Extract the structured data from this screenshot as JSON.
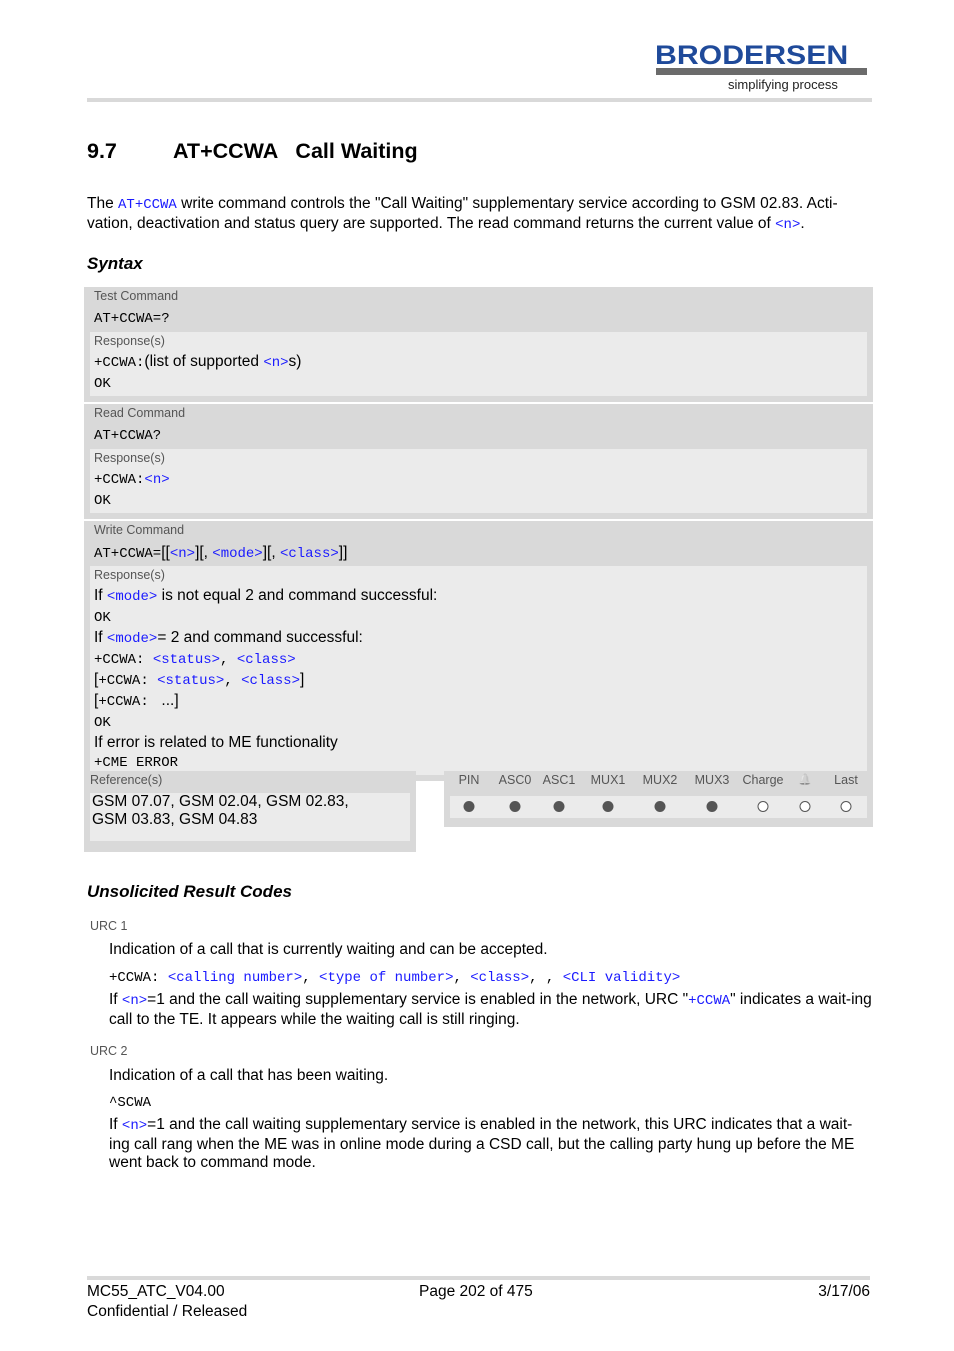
{
  "header": {
    "logo_text": "BRODERSEN",
    "logo_tagline": "simplifying process",
    "logo_color": "#1f4a9a"
  },
  "section": {
    "number": "9.7",
    "title": "AT+CCWA   Call Waiting"
  },
  "intro": [
    {
      "k": "t",
      "v": "The "
    },
    {
      "k": "l",
      "v": "AT+CCWA"
    },
    {
      "k": "t",
      "v": " write command controls the \"Call Waiting\" supplementary service according to GSM 02.83. Acti-vation, deactivation and status query are supported. The read command returns the current value of "
    },
    {
      "k": "l",
      "v": "<n>"
    },
    {
      "k": "t",
      "v": "."
    }
  ],
  "syntax_heading": "Syntax",
  "test": {
    "label": "Test Command",
    "command": "AT+CCWA=?",
    "resp_label": "Response(s)",
    "lines": [
      [
        {
          "k": "m",
          "v": "+CCWA:"
        },
        {
          "k": "t",
          "v": "(list of supported "
        },
        {
          "k": "l",
          "v": "<n>"
        },
        {
          "k": "t",
          "v": "s)"
        }
      ],
      [
        {
          "k": "m",
          "v": "OK"
        }
      ]
    ]
  },
  "read": {
    "label": "Read Command",
    "command": "AT+CCWA?",
    "resp_label": "Response(s)",
    "lines": [
      [
        {
          "k": "m",
          "v": "+CCWA:"
        },
        {
          "k": "l",
          "v": "<n>"
        }
      ],
      [
        {
          "k": "m",
          "v": "OK"
        }
      ]
    ]
  },
  "write": {
    "label": "Write Command",
    "resp_label": "Response(s)",
    "command": [
      {
        "k": "m",
        "v": "AT+CCWA="
      },
      {
        "k": "t",
        "v": "[["
      },
      {
        "k": "l",
        "v": "<n>"
      },
      {
        "k": "t",
        "v": "][, "
      },
      {
        "k": "l",
        "v": "<mode>"
      },
      {
        "k": "t",
        "v": "][, "
      },
      {
        "k": "l",
        "v": "<class>"
      },
      {
        "k": "t",
        "v": "]]"
      }
    ],
    "lines": [
      [
        {
          "k": "t",
          "v": "If "
        },
        {
          "k": "l",
          "v": "<mode>"
        },
        {
          "k": "t",
          "v": " is not equal 2 and command successful:"
        }
      ],
      [
        {
          "k": "m",
          "v": "OK"
        }
      ],
      [
        {
          "k": "t",
          "v": "If "
        },
        {
          "k": "l",
          "v": "<mode>"
        },
        {
          "k": "t",
          "v": "= 2 and command successful:"
        }
      ],
      [
        {
          "k": "m",
          "v": "+CCWA: "
        },
        {
          "k": "l",
          "v": "<status>"
        },
        {
          "k": "m",
          "v": ", "
        },
        {
          "k": "l",
          "v": "<class>"
        }
      ],
      [
        {
          "k": "t",
          "v": "["
        },
        {
          "k": "m",
          "v": "+CCWA: "
        },
        {
          "k": "l",
          "v": "<status>"
        },
        {
          "k": "m",
          "v": ", "
        },
        {
          "k": "l",
          "v": "<class>"
        },
        {
          "k": "t",
          "v": "]"
        }
      ],
      [
        {
          "k": "t",
          "v": "["
        },
        {
          "k": "m",
          "v": "+CCWA: "
        },
        {
          "k": "t",
          "v": " ...]"
        }
      ],
      [
        {
          "k": "m",
          "v": "OK"
        }
      ],
      [
        {
          "k": "t",
          "v": "If error is related to ME functionality"
        }
      ],
      [
        {
          "k": "m",
          "v": "+CME ERROR"
        }
      ]
    ]
  },
  "reference": {
    "label": "Reference(s)",
    "text_line1": "GSM 07.07, GSM 02.04, GSM 02.83,",
    "text_line2": "GSM 03.83, GSM 04.83"
  },
  "status_table": {
    "columns": [
      {
        "label": "PIN",
        "state": "on"
      },
      {
        "label": "ASC0",
        "state": "on"
      },
      {
        "label": "ASC1",
        "state": "on"
      },
      {
        "label": "MUX1",
        "state": "on"
      },
      {
        "label": "MUX2",
        "state": "on"
      },
      {
        "label": "MUX3",
        "state": "on"
      },
      {
        "label": "Charge",
        "state": "off"
      },
      {
        "label": "",
        "icon": "alarm-bell-icon",
        "state": "off"
      },
      {
        "label": "Last",
        "state": "off"
      }
    ]
  },
  "urc_heading": "Unsolicited Result Codes",
  "urc1": {
    "label": "URC 1",
    "desc": "Indication of a call that is currently waiting and can be accepted.",
    "code": [
      {
        "k": "m",
        "v": "+CCWA: "
      },
      {
        "k": "l",
        "v": "<calling number>"
      },
      {
        "k": "m",
        "v": ", "
      },
      {
        "k": "l",
        "v": "<type of number>"
      },
      {
        "k": "m",
        "v": ", "
      },
      {
        "k": "l",
        "v": "<class>"
      },
      {
        "k": "m",
        "v": ", , "
      },
      {
        "k": "l",
        "v": "<CLI validity>"
      }
    ],
    "text": [
      {
        "k": "t",
        "v": "If "
      },
      {
        "k": "l",
        "v": "<n>"
      },
      {
        "k": "t",
        "v": "=1 and the call waiting supplementary service is enabled in the network, URC \""
      },
      {
        "k": "l",
        "v": "+CCWA"
      },
      {
        "k": "t",
        "v": "\" indicates a wait-ing call to the TE. It appears while the waiting call is still ringing."
      }
    ]
  },
  "urc2": {
    "label": "URC 2",
    "desc": "Indication of a call that has been waiting.",
    "code": [
      {
        "k": "m",
        "v": "^SCWA"
      }
    ],
    "text": [
      {
        "k": "t",
        "v": "If "
      },
      {
        "k": "l",
        "v": "<n>"
      },
      {
        "k": "t",
        "v": "=1 and the call waiting supplementary service is enabled in the network, this URC indicates that a wait-ing call rang when the ME was in online mode during a CSD call, but the calling party hung up before the ME went back to command mode."
      }
    ]
  },
  "footer": {
    "doc": "MC55_ATC_V04.00",
    "status": "Confidential / Released",
    "page": "Page 202 of 475",
    "date": "3/17/06"
  }
}
